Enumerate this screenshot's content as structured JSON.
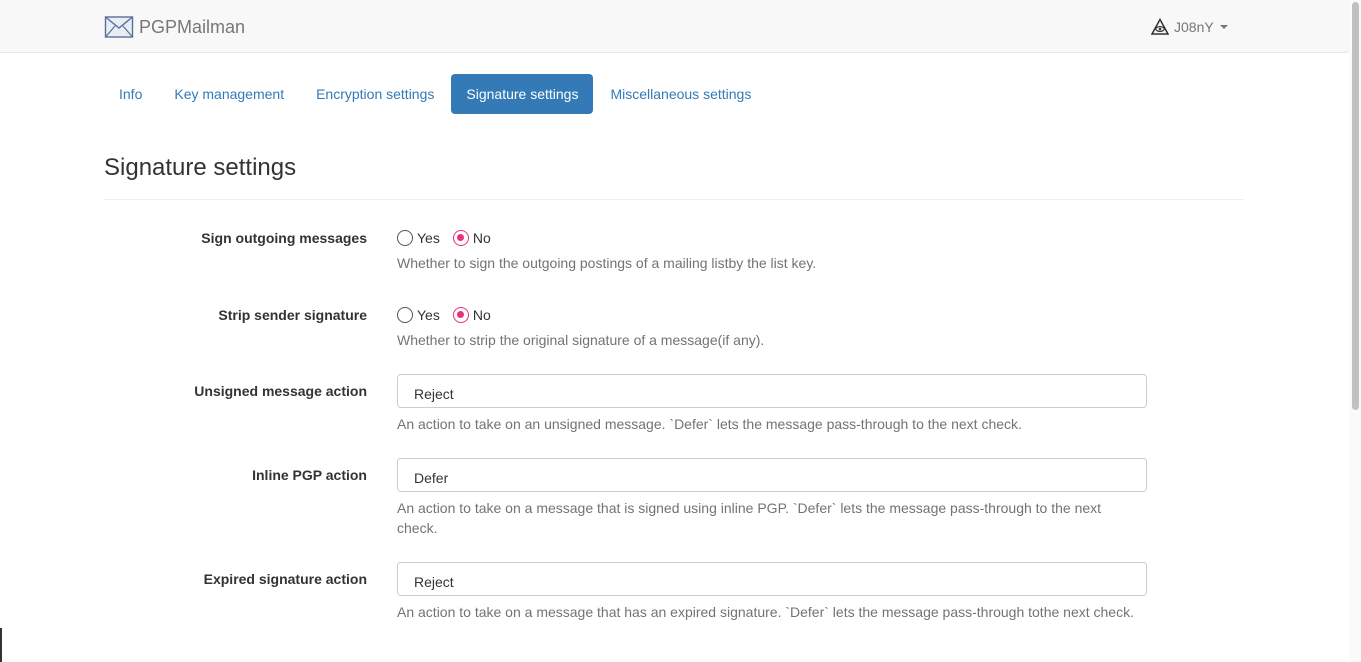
{
  "navbar": {
    "brand": "PGPMailman",
    "brand_icon": "envelope-icon",
    "user_icon": "eye-triangle-icon",
    "user": "J08nY"
  },
  "tabs": [
    {
      "label": "Info",
      "active": false
    },
    {
      "label": "Key management",
      "active": false
    },
    {
      "label": "Encryption settings",
      "active": false
    },
    {
      "label": "Signature settings",
      "active": true
    },
    {
      "label": "Miscellaneous settings",
      "active": false
    }
  ],
  "page": {
    "title": "Signature settings"
  },
  "form": {
    "sign_outgoing": {
      "label": "Sign outgoing messages",
      "options": [
        "Yes",
        "No"
      ],
      "selected": "No",
      "help": "Whether to sign the outgoing postings of a mailing listby the list key."
    },
    "strip_signature": {
      "label": "Strip sender signature",
      "options": [
        "Yes",
        "No"
      ],
      "selected": "No",
      "help": "Whether to strip the original signature of a message(if any)."
    },
    "unsigned_action": {
      "label": "Unsigned message action",
      "value": "Reject",
      "help": "An action to take on an unsigned message. `Defer` lets the message pass-through to the next check."
    },
    "inline_pgp_action": {
      "label": "Inline PGP action",
      "value": "Defer",
      "help": "An action to take on a message that is signed using inline PGP. `Defer` lets the message pass-through to the next check."
    },
    "expired_action": {
      "label": "Expired signature action",
      "value": "Reject",
      "help": "An action to take on a message that has an expired signature. `Defer` lets the message pass-through tothe next check."
    }
  },
  "colors": {
    "primary": "#337ab7",
    "radio_checked": "#e8317a",
    "help_text": "#737373"
  }
}
